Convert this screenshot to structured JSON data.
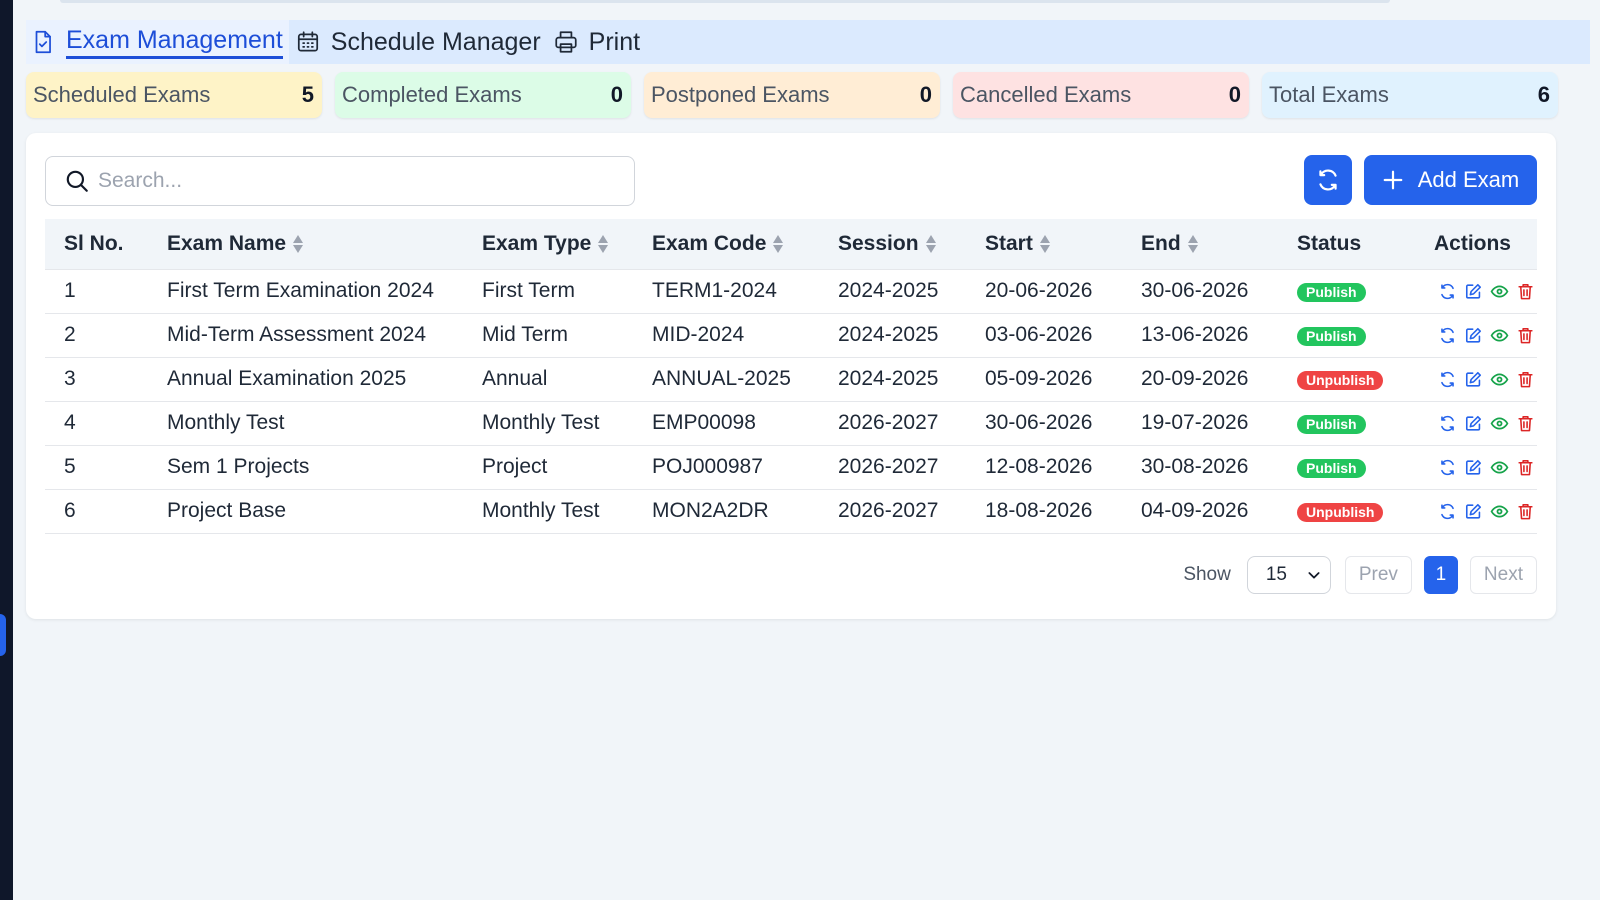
{
  "tabs": [
    {
      "label": "Exam Management",
      "icon": "document-check-icon",
      "active": true
    },
    {
      "label": "Schedule Manager",
      "icon": "calendar-icon",
      "active": false
    },
    {
      "label": "Print",
      "icon": "printer-icon",
      "active": false
    }
  ],
  "stats": [
    {
      "label": "Scheduled Exams",
      "count": "5",
      "color": "#fef3c7"
    },
    {
      "label": "Completed Exams",
      "count": "0",
      "color": "#dcfce7"
    },
    {
      "label": "Postponed Exams",
      "count": "0",
      "color": "#ffedd5"
    },
    {
      "label": "Cancelled Exams",
      "count": "0",
      "color": "#fee2e2"
    },
    {
      "label": "Total Exams",
      "count": "6",
      "color": "#e0f2fe"
    }
  ],
  "search": {
    "placeholder": "Search...",
    "value": ""
  },
  "toolbar": {
    "add_label": "Add Exam",
    "accent": "#2563eb"
  },
  "table": {
    "columns": [
      "Sl No.",
      "Exam Name",
      "Exam Type",
      "Exam Code",
      "Session",
      "Start",
      "End",
      "Status",
      "Actions"
    ],
    "rows": [
      {
        "sl": "1",
        "name": "First Term Examination 2024",
        "type": "First Term",
        "code": "TERM1-2024",
        "session": "2024-2025",
        "start": "20-06-2026",
        "end": "30-06-2026",
        "status": "Publish"
      },
      {
        "sl": "2",
        "name": "Mid-Term Assessment 2024",
        "type": "Mid Term",
        "code": "MID-2024",
        "session": "2024-2025",
        "start": "03-06-2026",
        "end": "13-06-2026",
        "status": "Publish"
      },
      {
        "sl": "3",
        "name": "Annual Examination 2025",
        "type": "Annual",
        "code": "ANNUAL-2025",
        "session": "2024-2025",
        "start": "05-09-2026",
        "end": "20-09-2026",
        "status": "Unpublish"
      },
      {
        "sl": "4",
        "name": "Monthly Test",
        "type": "Monthly Test",
        "code": "EMP00098",
        "session": "2026-2027",
        "start": "30-06-2026",
        "end": "19-07-2026",
        "status": "Publish"
      },
      {
        "sl": "5",
        "name": "Sem 1 Projects",
        "type": "Project",
        "code": "POJ000987",
        "session": "2026-2027",
        "start": "12-08-2026",
        "end": "30-08-2026",
        "status": "Publish"
      },
      {
        "sl": "6",
        "name": "Project Base",
        "type": "Monthly Test",
        "code": "MON2A2DR",
        "session": "2026-2027",
        "start": "18-08-2026",
        "end": "04-09-2026",
        "status": "Unpublish"
      }
    ]
  },
  "pagination": {
    "show_label": "Show",
    "page_size": "15",
    "prev_label": "Prev",
    "current_page": "1",
    "next_label": "Next"
  }
}
